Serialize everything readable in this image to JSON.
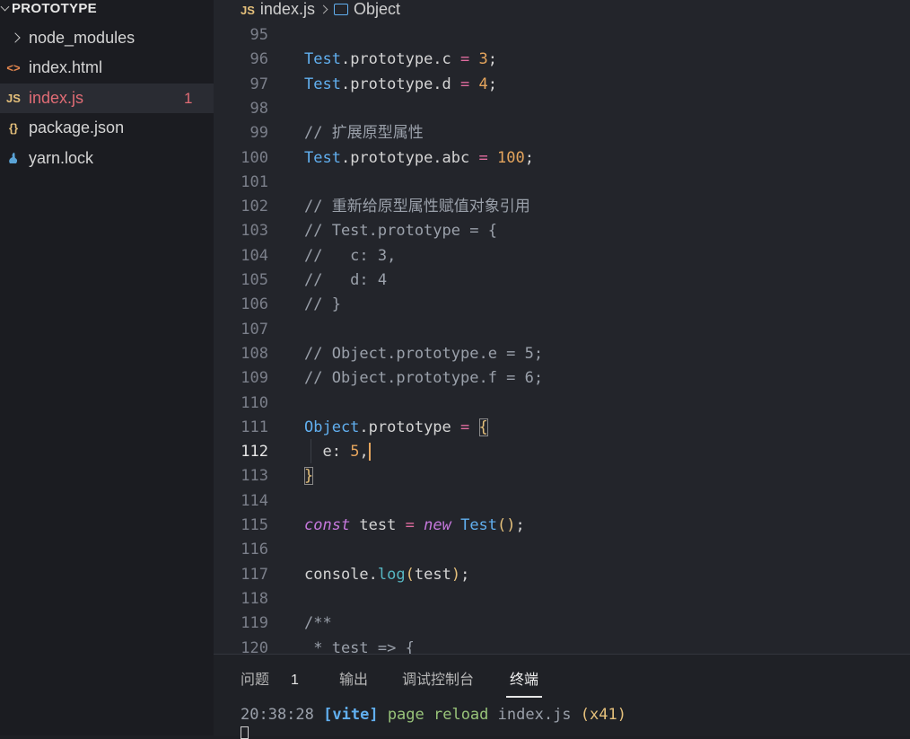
{
  "sidebar": {
    "section_title": "PROTOTYPE",
    "items": [
      {
        "icon": "chevron-right-icon",
        "label": "node_modules",
        "badge": ""
      },
      {
        "icon": "<>",
        "label": "index.html",
        "badge": ""
      },
      {
        "icon": "JS",
        "label": "index.js",
        "badge": "1"
      },
      {
        "icon": "{}",
        "label": "package.json",
        "badge": ""
      },
      {
        "icon": "yarn-icon",
        "label": "yarn.lock",
        "badge": ""
      }
    ]
  },
  "breadcrumb": {
    "file_icon": "JS",
    "file": "index.js",
    "symbol": "Object"
  },
  "editor": {
    "current_line": "112",
    "lines": [
      {
        "n": "95",
        "code": ""
      },
      {
        "n": "96",
        "code": "Test.prototype.c = 3;"
      },
      {
        "n": "97",
        "code": "Test.prototype.d = 4;"
      },
      {
        "n": "98",
        "code": ""
      },
      {
        "n": "99",
        "code": "// 扩展原型属性"
      },
      {
        "n": "100",
        "code": "Test.prototype.abc = 100;"
      },
      {
        "n": "101",
        "code": ""
      },
      {
        "n": "102",
        "code": "// 重新给原型属性赋值对象引用"
      },
      {
        "n": "103",
        "code": "// Test.prototype = {"
      },
      {
        "n": "104",
        "code": "//   c: 3,"
      },
      {
        "n": "105",
        "code": "//   d: 4"
      },
      {
        "n": "106",
        "code": "// }"
      },
      {
        "n": "107",
        "code": ""
      },
      {
        "n": "108",
        "code": "// Object.prototype.e = 5;"
      },
      {
        "n": "109",
        "code": "// Object.prototype.f = 6;"
      },
      {
        "n": "110",
        "code": ""
      },
      {
        "n": "111",
        "code": "Object.prototype = {"
      },
      {
        "n": "112",
        "code": "  e: 5,"
      },
      {
        "n": "113",
        "code": "}"
      },
      {
        "n": "114",
        "code": ""
      },
      {
        "n": "115",
        "code": "const test = new Test();"
      },
      {
        "n": "116",
        "code": ""
      },
      {
        "n": "117",
        "code": "console.log(test);"
      },
      {
        "n": "118",
        "code": ""
      },
      {
        "n": "119",
        "code": "/**"
      },
      {
        "n": "120",
        "code": " * test => {"
      }
    ]
  },
  "panel": {
    "tabs": [
      {
        "label": "问题",
        "count": "1"
      },
      {
        "label": "输出"
      },
      {
        "label": "调试控制台"
      },
      {
        "label": "终端"
      }
    ],
    "active_tab": "终端",
    "terminal": {
      "time": "20:38:28",
      "tag": "[vite]",
      "message": "page reload",
      "file": "index.js",
      "count": "(x41)"
    }
  },
  "colors": {
    "editor_bg": "#23252b",
    "sidebar_bg": "#1b1c21",
    "class_blue": "#61afef",
    "number_orange": "#e5a55d",
    "operator_pink": "#e06c9f",
    "keyword_purple": "#c678dd",
    "error_red": "#e06c75"
  }
}
